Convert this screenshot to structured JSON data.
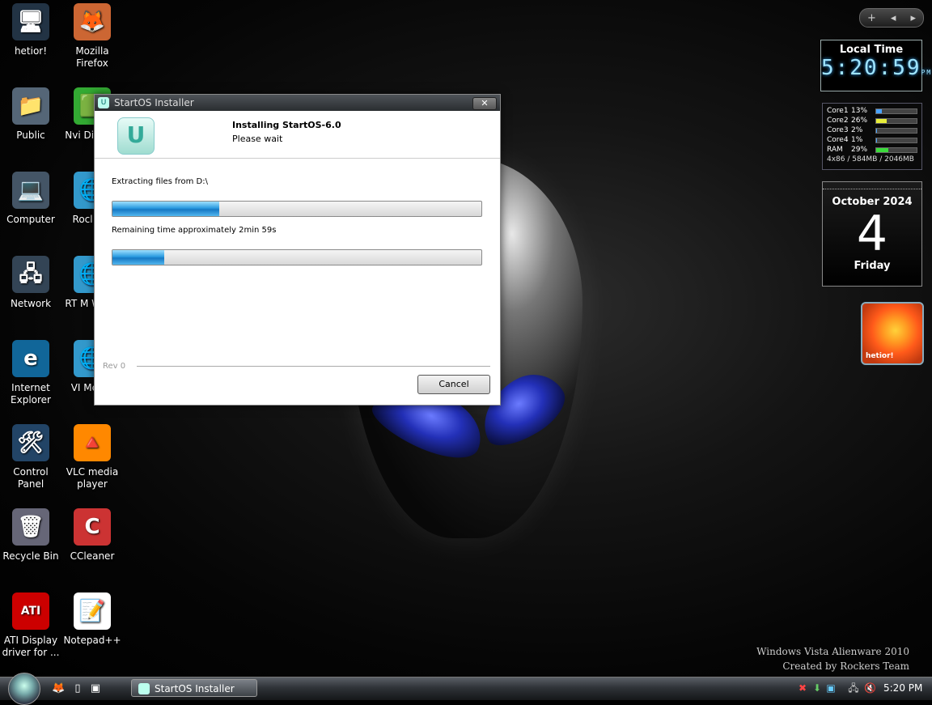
{
  "desktop": {
    "icons": [
      {
        "label": "hetior!",
        "glyph": "🖥"
      },
      {
        "label": "Mozilla Firefox",
        "glyph": "🦊"
      },
      {
        "label": "Public",
        "glyph": "📁"
      },
      {
        "label": "Nvi Display",
        "glyph": "🟩"
      },
      {
        "label": "Computer",
        "glyph": "💻"
      },
      {
        "label": "Rocl Tea",
        "glyph": "🌐"
      },
      {
        "label": "Network",
        "glyph": "🖧"
      },
      {
        "label": "RT M World",
        "glyph": "🌐"
      },
      {
        "label": "Internet Explorer",
        "glyph": "e"
      },
      {
        "label": "VI Memb",
        "glyph": "🌐"
      },
      {
        "label": "Control Panel",
        "glyph": "🛠"
      },
      {
        "label": "VLC media player",
        "glyph": "🔺"
      },
      {
        "label": "Recycle Bin",
        "glyph": "🗑"
      },
      {
        "label": "CCleaner",
        "glyph": "C"
      },
      {
        "label": "ATI Display driver for ...",
        "glyph": "ATI"
      },
      {
        "label": "Notepad++",
        "glyph": "📝"
      }
    ]
  },
  "gadgets": {
    "toolbar": {
      "add": "+",
      "prev": "◂",
      "next": "▸"
    },
    "clock": {
      "title": "Local Time",
      "time": "5:20:59",
      "ampm": "PM"
    },
    "cpu": {
      "rows": [
        {
          "name": "Core1",
          "pct": "13%",
          "level": 0.13,
          "color": "#4aa3ff"
        },
        {
          "name": "Core2",
          "pct": "26%",
          "level": 0.26,
          "color": "#e8ee3a"
        },
        {
          "name": "Core3",
          "pct": "2%",
          "level": 0.02,
          "color": "#4aa3ff"
        },
        {
          "name": "Core4",
          "pct": "1%",
          "level": 0.01,
          "color": "#4aa3ff"
        },
        {
          "name": "RAM",
          "pct": "29%",
          "level": 0.29,
          "color": "#3bdc3b"
        }
      ],
      "footer": "4x86 / 584MB / 2046MB"
    },
    "calendar": {
      "month": "October 2024",
      "day": "4",
      "weekday": "Friday"
    },
    "photo": {
      "label": "hetior!"
    }
  },
  "watermark": {
    "line1": "Windows Vista Alienware 2010",
    "line2": "Created by Rockers Team"
  },
  "installer": {
    "title": "StartOS Installer",
    "close": "✕",
    "logo_glyph": "U",
    "heading": "Installing StartOS-6.0",
    "subheading": "Please wait",
    "extracting": "Extracting files from D:\\",
    "progress1": 0.29,
    "remaining": "Remaining time approximately 2min 59s",
    "progress2": 0.14,
    "rev": "Rev 0",
    "cancel": "Cancel"
  },
  "taskbar": {
    "window_button": "StartOS Installer",
    "time": "5:20 PM"
  }
}
